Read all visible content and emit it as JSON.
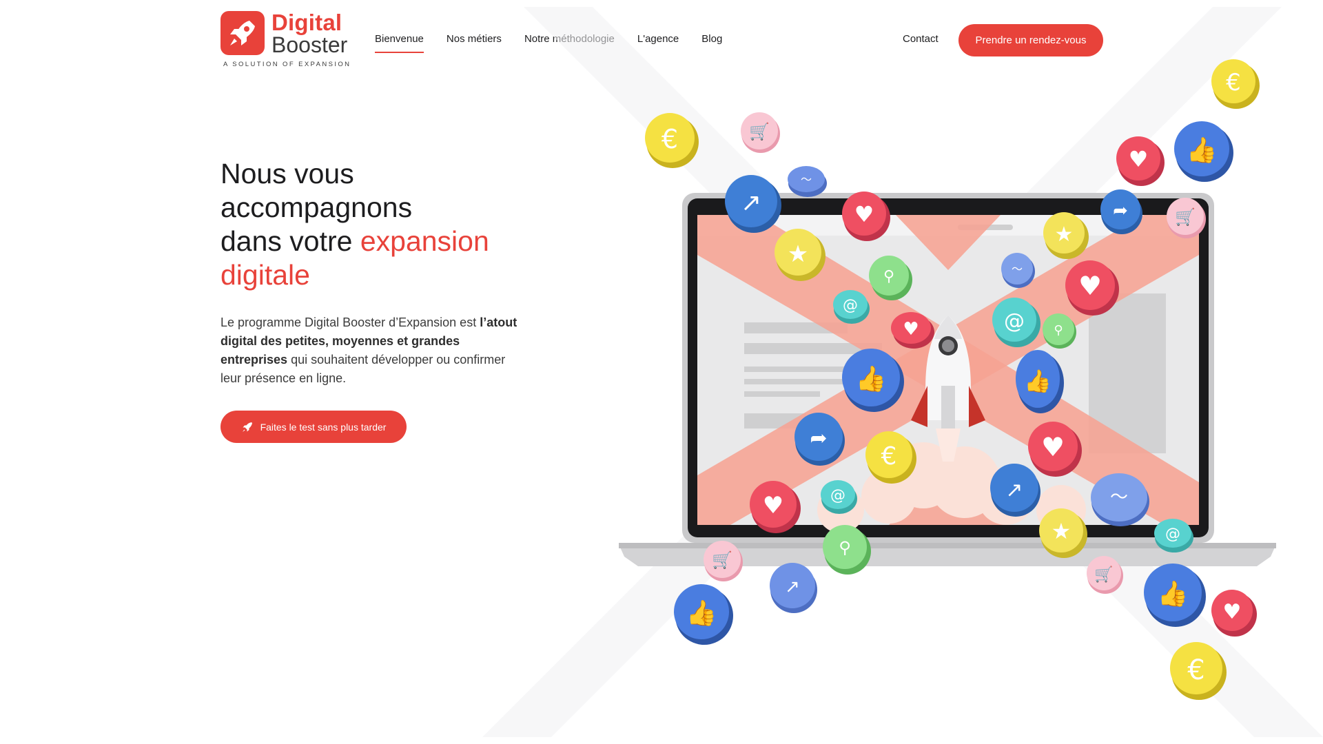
{
  "brand": {
    "name_line1": "Digital",
    "name_line2": "Booster",
    "tagline": "A SOLUTION OF EXPANSION",
    "accent_color": "#e8423a"
  },
  "nav": {
    "items": [
      {
        "label": "Bienvenue",
        "active": true
      },
      {
        "label": "Nos métiers",
        "active": false
      },
      {
        "label": "Notre méthodologie",
        "active": false
      },
      {
        "label": "L'agence",
        "active": false
      },
      {
        "label": "Blog",
        "active": false
      }
    ],
    "contact_label": "Contact",
    "cta_label": "Prendre un rendez-vous"
  },
  "hero": {
    "title_line1": "Nous vous",
    "title_line2": "accompagnons",
    "title_line3_plain": "dans votre ",
    "title_line3_accent": "expansion",
    "title_line4_accent": "digitale",
    "desc_part1": "Le programme Digital Booster d’Expansion est ",
    "desc_bold": "l’atout digital des petites, moyennes et grandes entreprises",
    "desc_part2": " qui souhaitent développer ou confirmer leur présence en ligne.",
    "cta_label": "Faites le test sans plus tarder",
    "cta_icon": "rocket-icon"
  },
  "illustration": {
    "icons": [
      "euro-coin-icon",
      "cart-icon",
      "like-icon",
      "heart-icon",
      "share-icon",
      "star-icon",
      "at-icon",
      "search-icon",
      "trend-icon",
      "rocket-icon",
      "laptop-icon"
    ],
    "colors": {
      "euro": "#f5e142",
      "heart": "#ef4f62",
      "like": "#4a7de0",
      "share": "#3f7fd6",
      "star": "#f3e35a",
      "at": "#58d2cf",
      "search": "#8ee08c",
      "cart": "#f7b7c6",
      "x_shape": "#f6a393"
    }
  }
}
